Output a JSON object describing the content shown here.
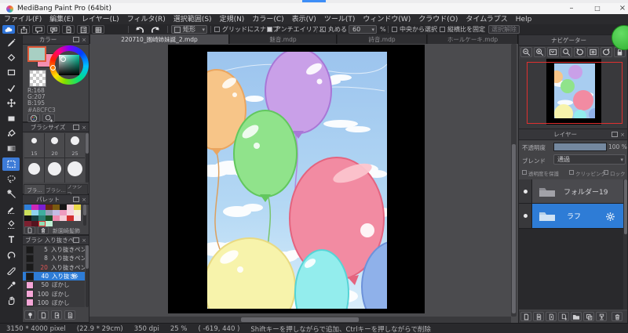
{
  "titlebar": {
    "title": "MediBang Paint Pro (64bit)"
  },
  "window_controls": {
    "minimize": "–",
    "maximize": "□",
    "close": "×"
  },
  "icons_text": {
    "close": "×",
    "caret": "▾"
  },
  "menu": {
    "items": [
      "ファイル(F)",
      "編集(E)",
      "レイヤー(L)",
      "フィルタ(R)",
      "選択範囲(S)",
      "定規(N)",
      "カラー(C)",
      "表示(V)",
      "ツール(T)",
      "ウィンドウ(W)",
      "クラウド(O)",
      "タイムラプス",
      "Help"
    ]
  },
  "options_bar": {
    "shape_label": "矩形",
    "snap_grid": "グリッドにスナップ",
    "antialias": "アンチエイリアス",
    "round_label": "丸める",
    "round_value": "60",
    "percent": "%",
    "from_center": "中央から選択",
    "fixed_ratio": "縦横比を固定",
    "deselect": "選択解除"
  },
  "color_panel": {
    "title": "カラー",
    "r": "R:168",
    "g": "G:207",
    "b": "B:195",
    "hex": "#A8CFC3",
    "fg_color": "#a8cfc3",
    "bg_color": "#f48fb1"
  },
  "brush_size_panel": {
    "title": "ブラシサイズ",
    "sizes": [
      "15",
      "20",
      "25"
    ],
    "tabs": [
      "ブラ…",
      "ブラシ…",
      "ブラシコ…"
    ]
  },
  "palette_panel": {
    "title": "パレット",
    "name": "新園崎髪飾",
    "rows": [
      [
        "#2f7fd9",
        "#cc29b8",
        "#7a1fd0",
        "#6b2a14",
        "#7a5a10",
        "#151515",
        "#f2ccd8",
        "#ead84a"
      ],
      [
        "#cce05c",
        "#8fd4f0",
        "#3fae9e",
        "#9aa0b8",
        "#c4bce4",
        "#ee9cc0",
        "#f6d6e2",
        "#f6f0da"
      ],
      [
        "#141414",
        "#173f42",
        "#2a7f72",
        "#1c5229",
        "#ef8cb0",
        "#f7cdd9",
        "#d12f2f",
        "#f2e6ea"
      ],
      [
        "#7c2030",
        "#55131f",
        "#8fdfb4",
        "#bff0d4",
        "#434346",
        "#434346",
        "#434346",
        "#434346"
      ]
    ],
    "selected": [
      3,
      2
    ]
  },
  "brush_panel": {
    "title": "ブラシ 入り抜きペン",
    "brushes": [
      {
        "size": "5",
        "name": "入り抜きペン",
        "swatch": "#1a1a1a"
      },
      {
        "size": "8",
        "name": "入り抜きペン",
        "swatch": "#1a1a1a"
      },
      {
        "size": "20",
        "name": "入り抜きペン",
        "swatch": "#1a1a1a",
        "red": true
      },
      {
        "size": "40",
        "name": "入り抜き",
        "swatch": "#1a1a1a",
        "selected": true
      },
      {
        "size": "50",
        "name": "ぼかし",
        "swatch": "#f4a6d7"
      },
      {
        "size": "100",
        "name": "ぼかし",
        "swatch": "#f4a6d7"
      },
      {
        "size": "100",
        "name": "ぼかし",
        "swatch": "#f4a6d7"
      }
    ]
  },
  "tabs": [
    {
      "label": "220710_園崎姉妹誕_2.mdp",
      "active": true
    },
    {
      "label": "魅音.mdp",
      "active": false
    },
    {
      "label": "詩音.mdp",
      "active": false
    },
    {
      "label": "ホールケーキ.mdp",
      "active": false
    }
  ],
  "navigator": {
    "title": "ナビゲーター",
    "view_rect_color": "#e03030"
  },
  "layers": {
    "title": "レイヤー",
    "opacity_label": "不透明度",
    "opacity_value": "100 %",
    "blend_label": "ブレンド",
    "blend_value": "通過",
    "protect": "透明度を保護",
    "clipping": "クリッピング",
    "lock": "ロック",
    "items": [
      {
        "name": "フォルダー19",
        "selected": false
      },
      {
        "name": "ラフ",
        "selected": true
      }
    ],
    "selection_color": "#2e7cd6"
  },
  "canvas": {
    "sky_color": "#a5cdf0",
    "balloon_colors": [
      "#f7c588",
      "#c9a0e8",
      "#90e38b",
      "#f28ba2",
      "#f7f3ab",
      "#93eded",
      "#8fb1ea"
    ]
  },
  "statusbar": {
    "size": "3150 * 4000 pixel",
    "cm": "(22.9 * 29cm)",
    "dpi": "350 dpi",
    "zoom": "25 %",
    "coords": "( -619, 440 )",
    "hint": "Shiftキーを押しながらで追加、Ctrlキーを押しながらで削除"
  }
}
